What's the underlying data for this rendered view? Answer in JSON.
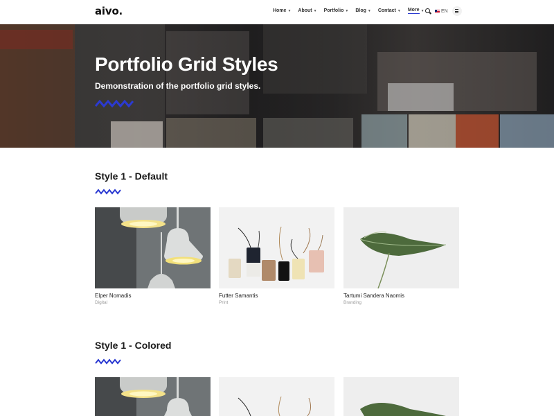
{
  "header": {
    "logo": "aivo.",
    "nav": [
      {
        "label": "Home"
      },
      {
        "label": "About"
      },
      {
        "label": "Portfolio"
      },
      {
        "label": "Blog"
      },
      {
        "label": "Contact"
      },
      {
        "label": "More"
      }
    ],
    "lang": "EN"
  },
  "hero": {
    "title": "Portfolio Grid Styles",
    "subtitle": "Demonstration of the portfolio grid styles."
  },
  "sections": [
    {
      "title": "Style 1 - Default",
      "items": [
        {
          "title": "Elper Nomadis",
          "category": "Digital"
        },
        {
          "title": "Futter Samantis",
          "category": "Print"
        },
        {
          "title": "Tartumi Sandera Naomis",
          "category": "Branding"
        }
      ]
    },
    {
      "title": "Style 1 - Colored",
      "items": []
    }
  ],
  "colors": {
    "accent": "#2b3ad2",
    "text": "#1a1a1a",
    "muted": "#9a9a9a"
  }
}
